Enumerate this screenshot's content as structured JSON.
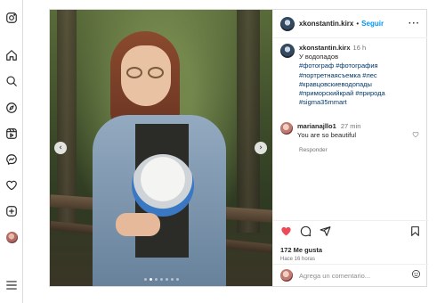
{
  "nav": {
    "items": [
      "instagram-icon",
      "home-icon",
      "search-icon",
      "explore-icon",
      "reels-icon",
      "messenger-icon",
      "notifications-icon",
      "create-icon",
      "profile-icon",
      "menu-icon"
    ]
  },
  "carousel": {
    "prev": "‹",
    "next": "›",
    "slide_count": 7,
    "active_index": 1
  },
  "post": {
    "header": {
      "username": "xkonstantin.kirx",
      "separator": "•",
      "follow_label": "Seguir",
      "more_label": "···"
    },
    "caption": {
      "username": "xkonstantin.kirx",
      "time": "16 h",
      "text": "У водопадов",
      "tags": [
        "#фотограф #фотография",
        "#портретнаясъемка #лес",
        "#кравцовскиеводопады",
        "#приморскийкрай #природа",
        "#sigma35mmart"
      ]
    },
    "comment": {
      "username": "marianajllo1",
      "time": "27 min",
      "text": "You are so beautiful",
      "reply_label": "Responder"
    },
    "likes": "172 Me gusta",
    "posted_ago": "Hace 16 horas",
    "add_comment_placeholder": "Agrega un comentario..."
  },
  "colors": {
    "like_red": "#ed4956",
    "link_blue": "#0095f6",
    "hashtag_blue": "#00376b",
    "muted": "#737373"
  }
}
